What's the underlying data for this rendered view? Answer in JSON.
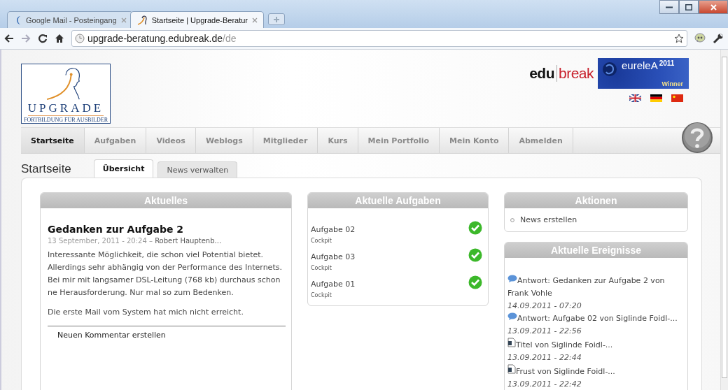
{
  "browser": {
    "tabs": [
      {
        "label": "Google Mail - Posteingang",
        "selected": false,
        "kind": "mail"
      },
      {
        "label": "Startseite | Upgrade-Beratur",
        "selected": true,
        "kind": "site"
      }
    ],
    "url": {
      "host": "upgrade-beratung.edubreak.de",
      "path": "/de"
    }
  },
  "header": {
    "logo": {
      "name": "UPGRADE",
      "tagline": "FORTBILDUNG FÜR AUSBILDER"
    },
    "brand": {
      "part_1": "edu",
      "part_2": "break"
    },
    "award": {
      "name": "eureleA",
      "year": "2011",
      "badge": "Winner"
    }
  },
  "nav": [
    {
      "label": "Startseite",
      "selected": true
    },
    {
      "label": "Aufgaben",
      "selected": false
    },
    {
      "label": "Videos",
      "selected": false
    },
    {
      "label": "Weblogs",
      "selected": false
    },
    {
      "label": "Mitglieder",
      "selected": false
    },
    {
      "label": "Kurs",
      "selected": false
    },
    {
      "label": "Mein Portfolio",
      "selected": false
    },
    {
      "label": "Mein Konto",
      "selected": false
    },
    {
      "label": "Abmelden",
      "selected": false
    }
  ],
  "page_title": "Startseite",
  "subtabs": [
    {
      "label": "Übersicht",
      "selected": true
    },
    {
      "label": "News verwalten",
      "selected": false
    }
  ],
  "news": {
    "title": "Aktuelles",
    "post_title": "Gedanken zur Aufgabe 2",
    "date": "13 September, 2011 - 20:24 –",
    "author": "Robert Hauptenb...",
    "paragraphs": [
      "Interessante Möglichkeit, die schon viel Potential bietet. Allerdings sehr abhängig von der Performance des Internets. Bei mir mit langsamer DSL-Leitung (768 kb) durchaus schon ne Herausforderung. Nur mal so zum Bedenken.",
      "Die erste Mail vom System hat mich nicht erreicht."
    ],
    "comment_link": "Neuen Kommentar erstellen"
  },
  "tasks": {
    "title": "Aktuelle Aufgaben",
    "items": [
      {
        "name": "Aufgabe 02",
        "category": "Cockpit",
        "done": true
      },
      {
        "name": "Aufgabe 03",
        "category": "Cockpit",
        "done": true
      },
      {
        "name": "Aufgabe 01",
        "category": "Cockpit",
        "done": true
      }
    ]
  },
  "actions": {
    "title": "Aktionen",
    "items": [
      "News erstellen"
    ]
  },
  "events": {
    "title": "Aktuelle Ereignisse",
    "items": [
      {
        "kind": "comment",
        "text": "Antwort: Gedanken zur Aufgabe 2 von Frank Vohle",
        "time": "14.09.2011 - 07:20"
      },
      {
        "kind": "comment",
        "text": "Antwort: Aufgabe 02 von Siglinde Foidl-...",
        "time": "13.09.2011 - 22:56"
      },
      {
        "kind": "document",
        "text": "Titel von Siglinde Foidl-...",
        "time": "13.09.2011 - 22:44"
      },
      {
        "kind": "document",
        "text": "Frust von Siglinde Foidl-...",
        "time": "13.09.2011 - 22:42"
      }
    ]
  }
}
